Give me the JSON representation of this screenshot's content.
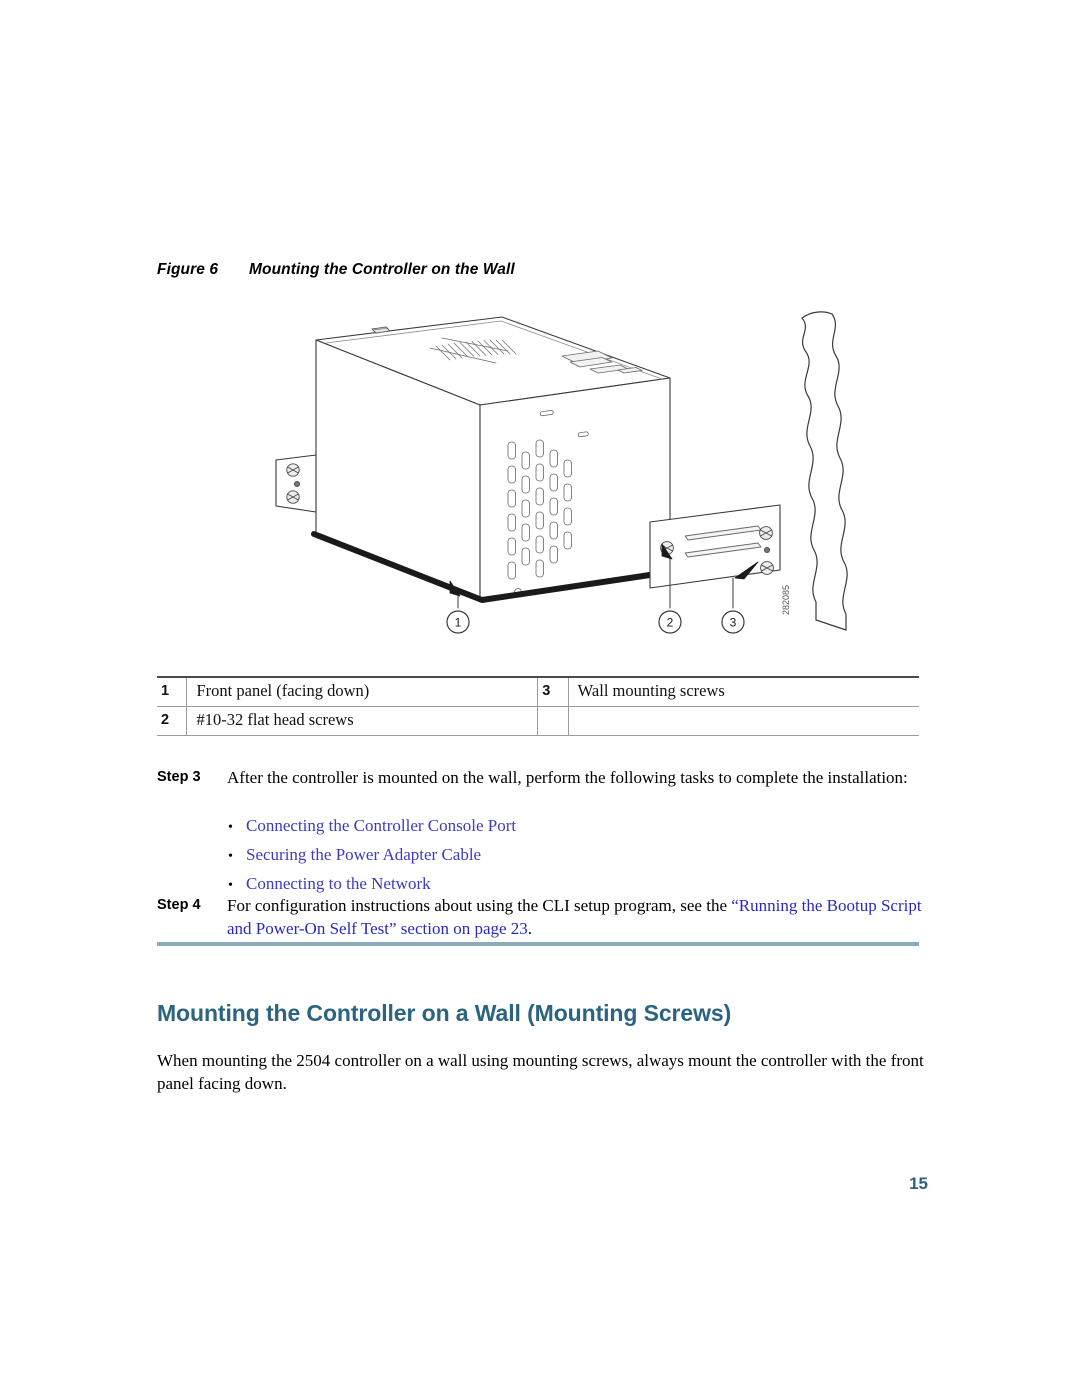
{
  "figure": {
    "label": "Figure 6",
    "title": "Mounting the Controller on the Wall",
    "art_id": "282085",
    "callouts": [
      "1",
      "2",
      "3"
    ]
  },
  "legend": {
    "rows": [
      {
        "num_left": "1",
        "text_left": "Front panel (facing down)",
        "num_right": "3",
        "text_right": "Wall mounting screws"
      },
      {
        "num_left": "2",
        "text_left": "#10-32 flat head screws",
        "num_right": "",
        "text_right": ""
      }
    ]
  },
  "step3": {
    "label": "Step 3",
    "text": "After the controller is mounted on the wall, perform the following tasks to complete the installation:",
    "bullets": [
      "Connecting the Controller Console Port",
      "Securing the Power Adapter Cable",
      "Connecting to the Network"
    ]
  },
  "step4": {
    "label": "Step 4",
    "text_before": "For configuration instructions about using the CLI setup program, see the ",
    "link_text": "“Running the Bootup Script and Power-On Self Test” section on page 23",
    "text_after": "."
  },
  "section": {
    "heading": "Mounting the Controller on a Wall (Mounting Screws)",
    "paragraph": "When mounting the 2504 controller on a wall using mounting screws, always mount the controller with the front panel facing down."
  },
  "footer": {
    "page_number": "15"
  },
  "colors": {
    "heading": "#2a6480",
    "rule": "#8fa9bd",
    "link": "#3b3bc4"
  }
}
